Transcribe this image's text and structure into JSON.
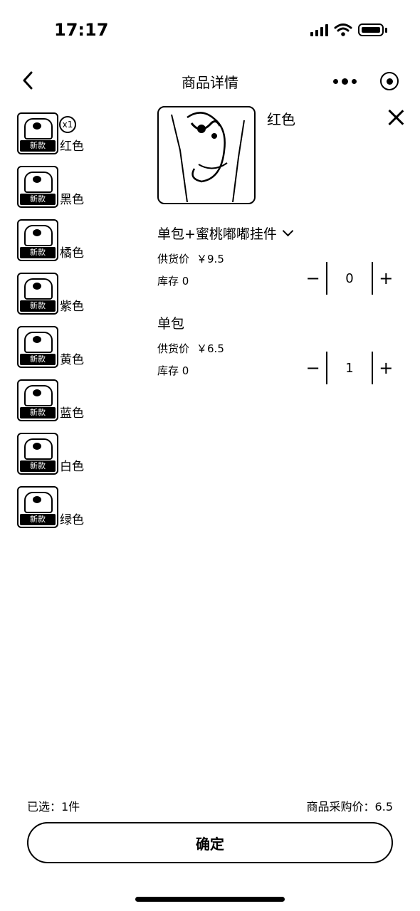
{
  "status_bar": {
    "time": "17:17"
  },
  "nav": {
    "title": "商品详情"
  },
  "colors": [
    {
      "label": "红色",
      "tag": "新款",
      "count": "x1"
    },
    {
      "label": "黑色",
      "tag": "新款"
    },
    {
      "label": "橘色",
      "tag": "新款"
    },
    {
      "label": "紫色",
      "tag": "新款"
    },
    {
      "label": "黄色",
      "tag": "新款"
    },
    {
      "label": "蓝色",
      "tag": "新款"
    },
    {
      "label": "白色",
      "tag": "新款"
    },
    {
      "label": "绿色",
      "tag": "新款"
    }
  ],
  "panel": {
    "selected_color": "红色",
    "variants": [
      {
        "name": "单包+蜜桃嘟嘟挂件",
        "price_label": "供货价",
        "price": "￥9.5",
        "stock": "库存 0",
        "qty": "0",
        "minus": "−",
        "plus": "+"
      },
      {
        "name": "单包",
        "price_label": "供货价",
        "price": "￥6.5",
        "stock": "库存 0",
        "qty": "1",
        "minus": "−",
        "plus": "+"
      }
    ]
  },
  "footer": {
    "selected": "已选：1件",
    "purchase_price": "商品采购价：6.5",
    "confirm": "确定"
  }
}
